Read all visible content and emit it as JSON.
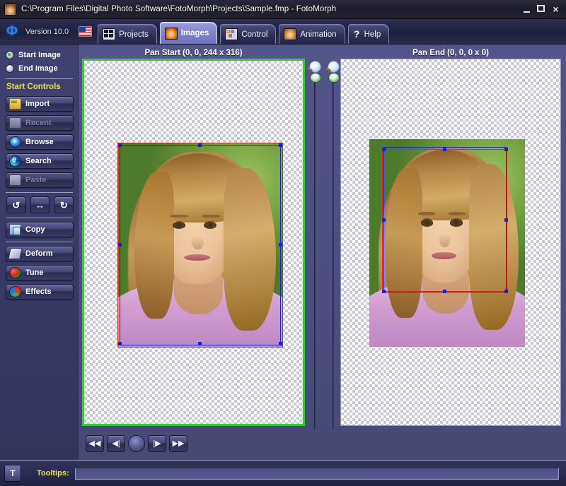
{
  "window": {
    "title": "C:\\Program Files\\Digital Photo Software\\FotoMorph\\Projects\\Sample.fmp - FotoMorph",
    "minimize_label": "",
    "maximize_label": "",
    "close_label": "×"
  },
  "branding": {
    "logo_glyph": "Ф",
    "version": "Version 10.0",
    "flag_name": "united-states-flag"
  },
  "tabs": [
    {
      "label": "Projects",
      "icon": "projects-icon",
      "active": false
    },
    {
      "label": "Images",
      "icon": "images-icon",
      "active": true
    },
    {
      "label": "Control",
      "icon": "control-icon",
      "active": false
    },
    {
      "label": "Animation",
      "icon": "animation-icon",
      "active": false
    },
    {
      "label": "Help",
      "icon": "help-icon",
      "active": false
    }
  ],
  "sidebar": {
    "radios": [
      {
        "label": "Start Image",
        "selected": true
      },
      {
        "label": "End Image",
        "selected": false
      }
    ],
    "section_title": "Start Controls",
    "buttons": [
      {
        "label": "Import",
        "icon": "folder-import-icon",
        "disabled": false
      },
      {
        "label": "Recent",
        "icon": "folder-recent-icon",
        "disabled": true
      },
      {
        "label": "Browse",
        "icon": "disc-browse-icon",
        "disabled": false
      },
      {
        "label": "Search",
        "icon": "browser-search-icon",
        "disabled": false
      },
      {
        "label": "Paste",
        "icon": "clipboard-paste-icon",
        "disabled": true
      }
    ],
    "transform_buttons": [
      {
        "label": "↺",
        "name": "rotate-left-button"
      },
      {
        "label": "↔",
        "name": "flip-horizontal-button"
      },
      {
        "label": "↻",
        "name": "rotate-right-button"
      }
    ],
    "copy_button": {
      "label": "Copy",
      "icon": "copy-icon"
    },
    "effect_buttons": [
      {
        "label": "Deform",
        "icon": "deform-icon"
      },
      {
        "label": "Tune",
        "icon": "tune-icon"
      },
      {
        "label": "Effects",
        "icon": "effects-icon"
      }
    ]
  },
  "panels": {
    "start": {
      "header": "Pan Start (0, 0, 244 x 316)",
      "active": true,
      "border_color": "#3ec73e"
    },
    "end": {
      "header": "Pan End (0, 0, 0 x 0)",
      "active": false,
      "border_color": "#9094bb"
    }
  },
  "overlays": {
    "crop_rect_color": "#e02b18",
    "handle_rect_color": "#1624c8"
  },
  "sliders": [
    {
      "name": "zoom-slider-start",
      "icon": "magnifier-icon"
    },
    {
      "name": "zoom-slider-end",
      "icon": "magnifier-icon"
    }
  ],
  "transport": [
    {
      "label": "◀◀",
      "name": "first-frame-button"
    },
    {
      "label": "◀|",
      "name": "previous-frame-button"
    },
    {
      "label": "",
      "name": "play-button"
    },
    {
      "label": "|▶",
      "name": "next-frame-button"
    },
    {
      "label": "▶▶",
      "name": "last-frame-button"
    }
  ],
  "statusbar": {
    "badge": "T",
    "tooltips_label": "Tooltips:",
    "tooltips_value": ""
  }
}
